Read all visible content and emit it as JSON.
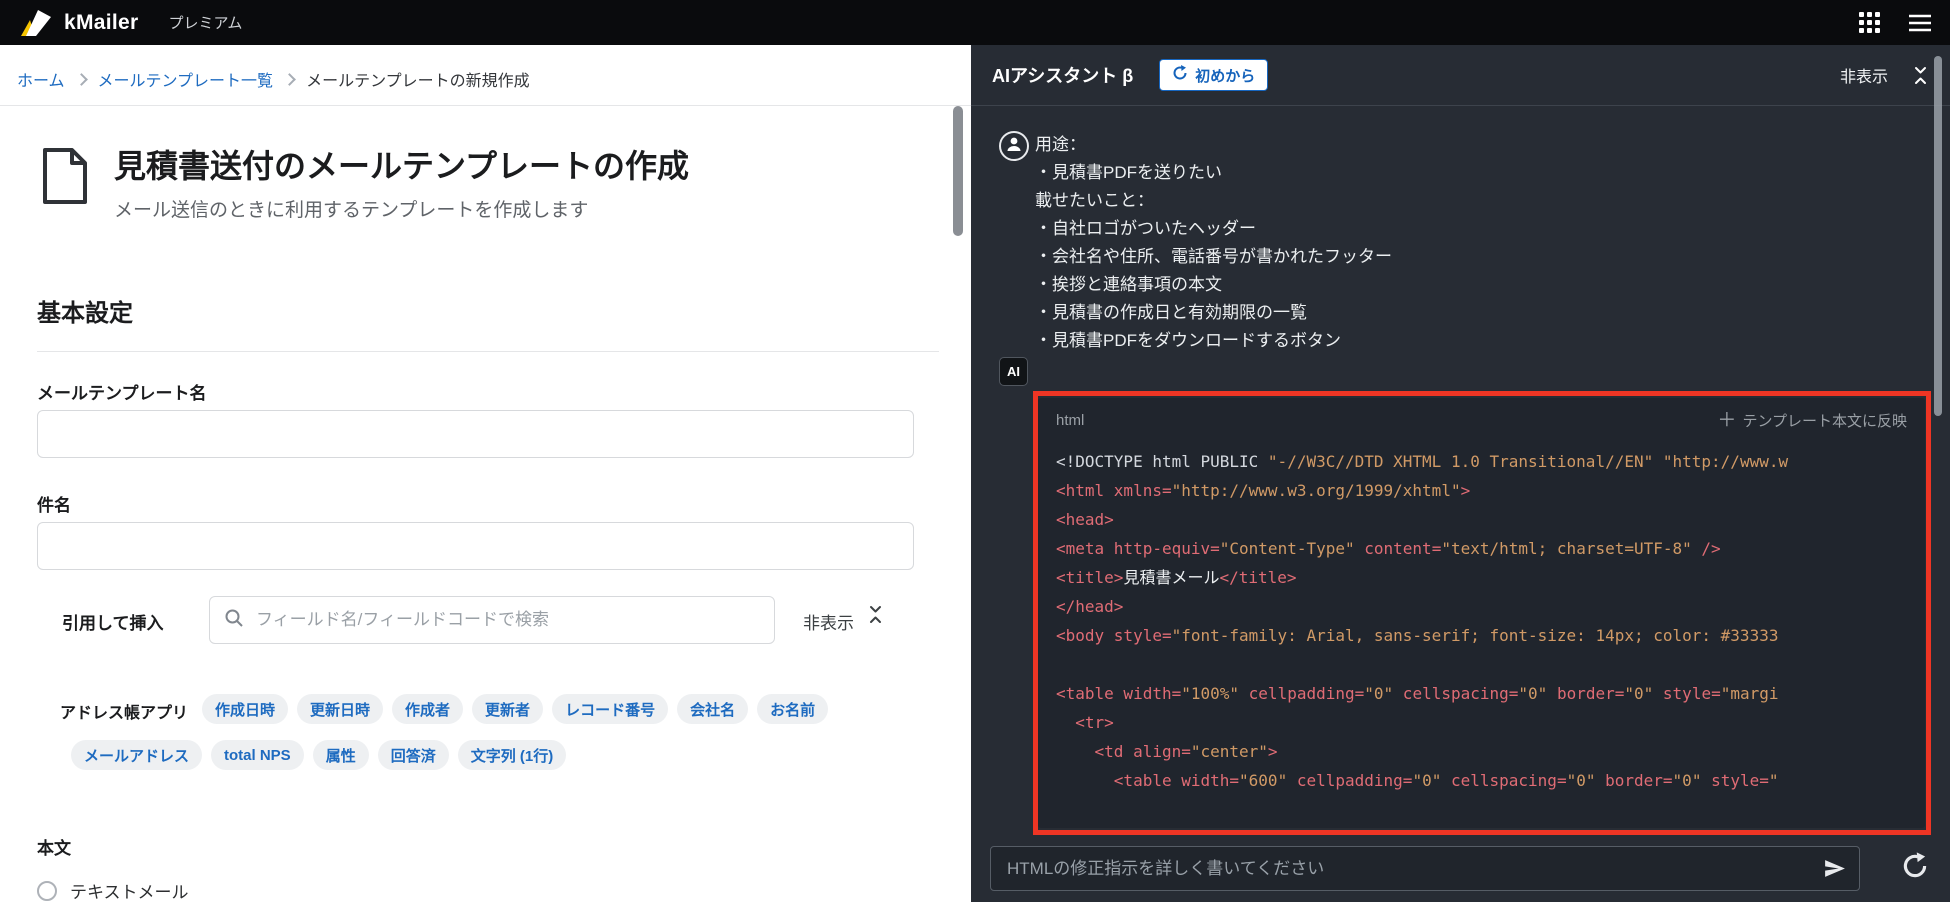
{
  "colors": {
    "accent_blue": "#1e6bc0",
    "brand_yellow": "#f5c400",
    "highlight_red": "#ee3524",
    "panel_dark": "#272c34"
  },
  "topbar": {
    "brand": "kMailer",
    "plan": "プレミアム"
  },
  "breadcrumb": {
    "items": [
      {
        "label": "ホーム",
        "link": true
      },
      {
        "label": "メールテンプレート一覧",
        "link": true
      },
      {
        "label": "メールテンプレートの新規作成",
        "link": false
      }
    ]
  },
  "page": {
    "title": "見積書送付のメールテンプレートの作成",
    "subtitle": "メール送信のときに利用するテンプレートを作成します",
    "basic_section_title": "基本設定",
    "template_name_label": "メールテンプレート名",
    "subject_label": "件名",
    "quote_insert_label": "引用して挿入",
    "field_search_placeholder": "フィールド名/フィールドコードで検索",
    "hide_label": "非表示",
    "address_book_label": "アドレス帳アプリ",
    "field_chips_row1": [
      "作成日時",
      "更新日時",
      "作成者",
      "更新者",
      "レコード番号",
      "会社名",
      "お名前"
    ],
    "field_chips_row2": [
      "メールアドレス",
      "total NPS",
      "属性",
      "回答済",
      "文字列 (1行)"
    ],
    "body_label": "本文",
    "body_text_option": "テキストメール"
  },
  "assistant": {
    "title": "AIアシスタント β",
    "restart_button": "初めから",
    "hide_label": "非表示",
    "ai_badge": "AI",
    "user_message": [
      "用途：",
      "・見積書PDFを送りたい",
      "載せたいこと：",
      "・自社ロゴがついたヘッダー",
      "・会社名や住所、電話番号が書かれたフッター",
      "・挨拶と連絡事項の本文",
      "・見積書の作成日と有効期限の一覧",
      "・見積書PDFをダウンロードするボタン"
    ],
    "code_block": {
      "language_label": "html",
      "apply_icon": "＋",
      "apply_label": "テンプレート本文に反映",
      "lines": [
        [
          [
            "pln",
            "<!DOCTYPE html PUBLIC "
          ],
          [
            "str",
            "\"-//W3C//DTD XHTML 1.0 Transitional//EN\""
          ],
          [
            "pln",
            " "
          ],
          [
            "str",
            "\"http://www.w"
          ]
        ],
        [
          [
            "tag",
            "<html xmlns="
          ],
          [
            "str",
            "\"http://www.w3.org/1999/xhtml\""
          ],
          [
            "tag",
            ">"
          ]
        ],
        [
          [
            "tag",
            "<head>"
          ]
        ],
        [
          [
            "tag",
            "<meta http-equiv="
          ],
          [
            "str",
            "\"Content-Type\""
          ],
          [
            "tag",
            " content="
          ],
          [
            "str",
            "\"text/html; charset=UTF-8\""
          ],
          [
            "tag",
            " />"
          ]
        ],
        [
          [
            "tag",
            "<title>"
          ],
          [
            "txt",
            "見積書メール"
          ],
          [
            "tag",
            "</title>"
          ]
        ],
        [
          [
            "tag",
            "</head>"
          ]
        ],
        [
          [
            "tag",
            "<body style="
          ],
          [
            "str",
            "\"font-family: Arial, sans-serif; font-size: 14px; color: #33333"
          ]
        ],
        [],
        [
          [
            "tag",
            "<table width="
          ],
          [
            "str",
            "\"100%\""
          ],
          [
            "tag",
            " cellpadding="
          ],
          [
            "str",
            "\"0\""
          ],
          [
            "tag",
            " cellspacing="
          ],
          [
            "str",
            "\"0\""
          ],
          [
            "tag",
            " border="
          ],
          [
            "str",
            "\"0\""
          ],
          [
            "tag",
            " style="
          ],
          [
            "str",
            "\"margi"
          ]
        ],
        [
          [
            "tag",
            "  <tr>"
          ]
        ],
        [
          [
            "tag",
            "    <td align="
          ],
          [
            "str",
            "\"center\""
          ],
          [
            "tag",
            ">"
          ]
        ],
        [
          [
            "tag",
            "      <table width="
          ],
          [
            "str",
            "\"600\""
          ],
          [
            "tag",
            " cellpadding="
          ],
          [
            "str",
            "\"0\""
          ],
          [
            "tag",
            " cellspacing="
          ],
          [
            "str",
            "\"0\""
          ],
          [
            "tag",
            " border="
          ],
          [
            "str",
            "\"0\""
          ],
          [
            "tag",
            " style="
          ],
          [
            "str",
            "\""
          ]
        ]
      ]
    },
    "composer": {
      "placeholder": "HTMLの修正指示を詳しく書いてください"
    }
  }
}
